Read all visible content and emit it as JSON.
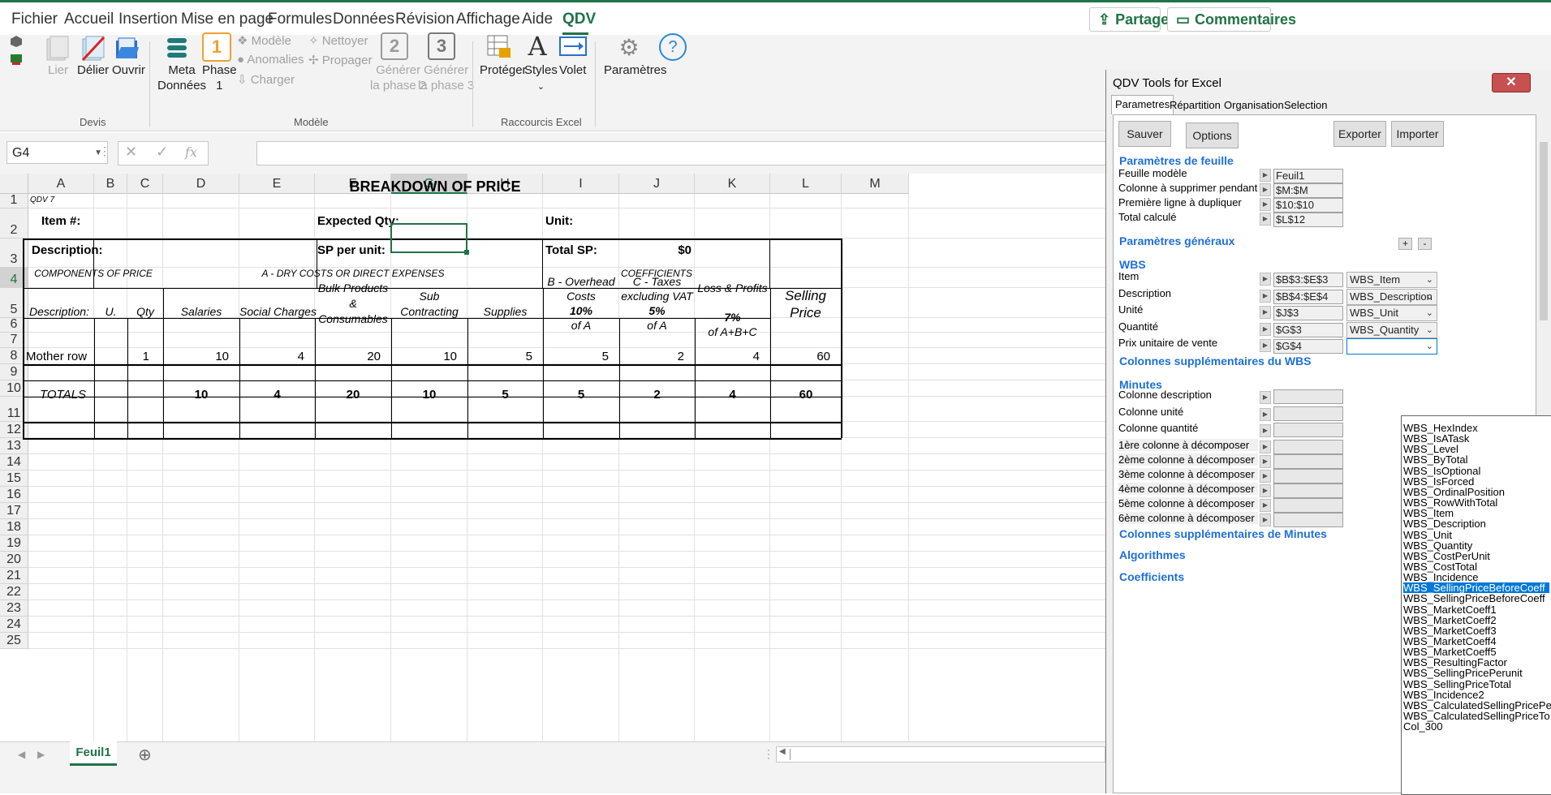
{
  "menu": {
    "items": [
      "Fichier",
      "Accueil",
      "Insertion",
      "Mise en page",
      "Formules",
      "Données",
      "Révision",
      "Affichage",
      "Aide",
      "QDV"
    ],
    "active": "QDV",
    "share_label": "Partager",
    "comments_label": "Commentaires"
  },
  "ribbon": {
    "devis": {
      "lier": "Lier",
      "delier": "Délier",
      "ouvrir": "Ouvrir",
      "group": "Devis"
    },
    "modele": {
      "meta_line1": "Meta",
      "meta_line2": "Données",
      "phase1_line1": "Phase",
      "phase1_line2": "1",
      "phase1_num": "1",
      "modele": "Modèle",
      "anomalies": "Anomalies",
      "charger": "Charger",
      "nettoyer": "Nettoyer",
      "propager": "Propager",
      "gen2_line1": "Générer",
      "gen2_line2": "la phase 2",
      "gen2_num": "2",
      "gen3_line1": "Générer",
      "gen3_line2": "la phase 3",
      "gen3_num": "3",
      "group": "Modèle"
    },
    "raccourcis": {
      "proteger": "Protéger",
      "styles": "Styles",
      "volet": "Volet",
      "group": "Raccourcis Excel"
    },
    "parametres": "Paramètres"
  },
  "formula_bar": {
    "name_box": "G4",
    "fx": "fx",
    "value": ""
  },
  "grid": {
    "columns": [
      "A",
      "B",
      "C",
      "D",
      "E",
      "F",
      "G",
      "H",
      "I",
      "J",
      "K",
      "L",
      "M"
    ],
    "selected_column": "G",
    "rows": [
      "1",
      "2",
      "3",
      "4",
      "5",
      "6",
      "7",
      "8",
      "9",
      "10",
      "11",
      "12",
      "13",
      "14",
      "15",
      "16",
      "17",
      "18",
      "19",
      "20",
      "21",
      "22",
      "23",
      "24",
      "25"
    ]
  },
  "sheet": {
    "title": "BREAKDOWN OF PRICE",
    "qdv7": "QDV 7",
    "item_label": "Item #:",
    "desc_label": "Description:",
    "expected_qty_label": "Expected Qty:",
    "sp_unit_label": "SP per unit:",
    "unit_label": "Unit:",
    "total_sp_label": "Total SP:",
    "total_sp_value": "$0",
    "components_hdr": "COMPONENTS OF PRICE",
    "dry_costs_hdr": "A - DRY COSTS OR DIRECT EXPENSES",
    "coefficients_hdr": "COEFFICIENTS",
    "selling_price_hdr_1": "Selling",
    "selling_price_hdr_2": "Price",
    "col_description": "Description:",
    "col_unit": "U.",
    "col_qty": "Qty",
    "col_salaries": "Salaries",
    "col_social": "Social Charges",
    "col_bulk_1": "Bulk Products",
    "col_bulk_2": "&",
    "col_bulk_3": "Consumables",
    "col_sub_1": "Sub",
    "col_sub_2": "Contracting",
    "col_supplies": "Supplies",
    "col_overhead_1": "B - Overhead",
    "col_overhead_2": "Costs",
    "col_overhead_pct": "10%",
    "col_overhead_of": "of A",
    "col_taxes_1": "C - Taxes",
    "col_taxes_2": "excluding VAT",
    "col_taxes_pct": "5%",
    "col_taxes_of": "of A",
    "col_loss": "Loss & Profits",
    "col_loss_pct": "7%",
    "col_loss_of": "of A+B+C",
    "mother_row": {
      "label": "Mother row",
      "qty": "1",
      "salaries": "10",
      "social": "4",
      "bulk": "20",
      "sub": "10",
      "supplies": "5",
      "overhead": "5",
      "taxes": "2",
      "loss": "4",
      "selling": "60"
    },
    "totals": {
      "label": "TOTALS",
      "salaries": "10",
      "social": "4",
      "bulk": "20",
      "sub": "10",
      "supplies": "5",
      "overhead": "5",
      "taxes": "2",
      "loss": "4",
      "selling": "60"
    }
  },
  "sheet_tab": "Feuil1",
  "qdv_panel": {
    "title": "QDV Tools for Excel",
    "close": "✕",
    "tabs": [
      "Parametres",
      "Répartition",
      "Organisation",
      "Selection"
    ],
    "buttons": {
      "sauver": "Sauver",
      "options": "Options",
      "exporter": "Exporter",
      "importer": "Importer"
    },
    "sections": {
      "feuille": "Paramètres de feuille",
      "generaux": "Paramètres généraux",
      "wbs": "WBS",
      "wbs_extra": "Colonnes supplémentaires du WBS",
      "minutes": "Minutes",
      "minutes_extra": "Colonnes supplémentaires de Minutes",
      "algorithmes": "Algorithmes",
      "coefficients": "Coefficients"
    },
    "feuille_rows": [
      {
        "label": "Feuille modèle",
        "value": "Feuil1"
      },
      {
        "label": "Colonne à supprimer pendant la co",
        "value": "$M:$M"
      },
      {
        "label": "Première ligne à dupliquer",
        "value": "$10:$10"
      },
      {
        "label": "Total calculé",
        "value": "$L$12"
      }
    ],
    "wbs_rows": [
      {
        "label": "Item",
        "value": "$B$3:$E$3",
        "combo": "WBS_Item"
      },
      {
        "label": "Description",
        "value": "$B$4:$E$4",
        "combo": "WBS_Description"
      },
      {
        "label": "Unité",
        "value": "$J$3",
        "combo": "WBS_Unit"
      },
      {
        "label": "Quantité",
        "value": "$G$3",
        "combo": "WBS_Quantity"
      },
      {
        "label": "Prix unitaire de vente",
        "value": "$G$4",
        "combo": ""
      }
    ],
    "minutes_rows": [
      "Colonne description",
      "Colonne unité",
      "Colonne quantité"
    ],
    "decompose_rows": [
      "1ère colonne à décomposer",
      "2ème colonne à décomposer",
      "3ème colonne à décomposer",
      "4ème colonne à décomposer",
      "5ème colonne à décomposer",
      "6ème colonne à décomposer"
    ],
    "plus": "+",
    "minus": "-"
  },
  "dropdown": {
    "selected": "WBS_SellingPriceBeforeCoeff",
    "items": [
      "WBS_HexIndex",
      "WBS_IsATask",
      "WBS_Level",
      "WBS_ByTotal",
      "WBS_IsOptional",
      "WBS_IsForced",
      "WBS_OrdinalPosition",
      "WBS_RowWithTotal",
      "WBS_Item",
      "WBS_Description",
      "WBS_Unit",
      "WBS_Quantity",
      "WBS_CostPerUnit",
      "WBS_CostTotal",
      "WBS_Incidence",
      "WBS_SellingPriceBeforeCoeff",
      "WBS_SellingPriceBeforeCoeff",
      "WBS_MarketCoeff1",
      "WBS_MarketCoeff2",
      "WBS_MarketCoeff3",
      "WBS_MarketCoeff4",
      "WBS_MarketCoeff5",
      "WBS_ResultingFactor",
      "WBS_SellingPricePerunit",
      "WBS_SellingPriceTotal",
      "WBS_Incidence2",
      "WBS_CalculatedSellingPricePe",
      "WBS_CalculatedSellingPriceTo",
      "Col_300"
    ]
  },
  "colors": {
    "excel_green": "#217346",
    "selection_blue": "#0078d7",
    "section_blue": "#1e6fd9",
    "close_red": "#c75050"
  }
}
